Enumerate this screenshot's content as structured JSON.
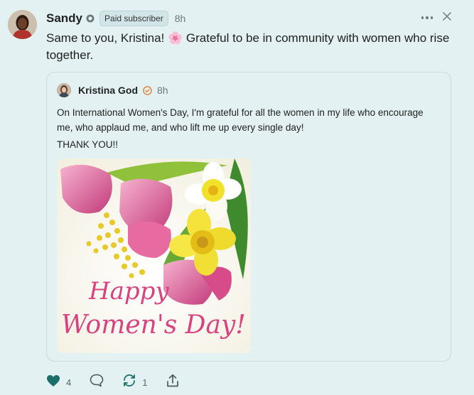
{
  "post": {
    "author": "Sandy",
    "badge": "Paid subscriber",
    "time": "8h",
    "body": "Same to you, Kristina! 🌸 Grateful to be in community with women who rise together."
  },
  "quoted": {
    "author": "Kristina God",
    "time": "8h",
    "text": "On International Women's Day, I'm grateful for all the women in my life who encourage me, who applaud me, and who lift me up every single day!",
    "thanks": "THANK YOU!!",
    "image": {
      "line1": "Happy",
      "line2": "Women's Day!"
    }
  },
  "footer": {
    "likes": "4",
    "restacks": "1"
  },
  "colors": {
    "background": "#e3f1f2",
    "like": "#1a6f6a",
    "restack": "#1a6f6a",
    "image_text": "#d8437f"
  },
  "icons": [
    "more-icon",
    "close-icon",
    "verified-icon",
    "heart-icon",
    "comment-icon",
    "restack-icon",
    "share-icon"
  ]
}
